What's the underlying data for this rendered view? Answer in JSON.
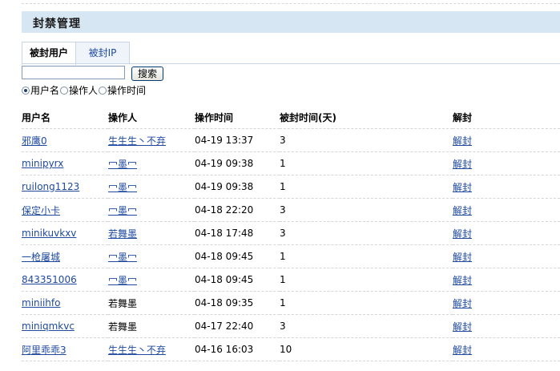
{
  "page_title": "封禁管理",
  "tabs": [
    {
      "label": "被封用户",
      "active": true
    },
    {
      "label": "被封IP",
      "active": false
    }
  ],
  "search": {
    "value": "",
    "button_label": "搜索"
  },
  "radio_options": [
    {
      "label": "用户名",
      "checked": true
    },
    {
      "label": "操作人",
      "checked": false
    },
    {
      "label": "操作时间",
      "checked": false
    }
  ],
  "table": {
    "headers": [
      "用户名",
      "操作人",
      "操作时间",
      "被封时间(天)",
      "解封"
    ],
    "rows": [
      {
        "username": "邪鹰0",
        "username_link": true,
        "operator": "生生生丶不弃",
        "operator_link": true,
        "time": "04-19 13:37",
        "days": "3",
        "action": "解封"
      },
      {
        "username": "minipyrx",
        "username_link": true,
        "operator": "冖墨冖",
        "operator_link": true,
        "time": "04-19 09:38",
        "days": "1",
        "action": "解封"
      },
      {
        "username": "ruilong1123",
        "username_link": true,
        "operator": "冖墨冖",
        "operator_link": true,
        "time": "04-19 09:38",
        "days": "1",
        "action": "解封"
      },
      {
        "username": "保定小卡",
        "username_link": true,
        "operator": "冖墨冖",
        "operator_link": true,
        "time": "04-18 22:20",
        "days": "3",
        "action": "解封"
      },
      {
        "username": "minikuvkxv",
        "username_link": true,
        "operator": "若舞墨",
        "operator_link": true,
        "time": "04-18 17:48",
        "days": "3",
        "action": "解封"
      },
      {
        "username": "一枪屠城",
        "username_link": true,
        "operator": "冖墨冖",
        "operator_link": true,
        "time": "04-18 09:45",
        "days": "1",
        "action": "解封"
      },
      {
        "username": "843351006",
        "username_link": true,
        "operator": "冖墨冖",
        "operator_link": true,
        "time": "04-18 09:45",
        "days": "1",
        "action": "解封"
      },
      {
        "username": "miniihfo",
        "username_link": true,
        "operator": "若舞墨",
        "operator_link": false,
        "time": "04-18 09:35",
        "days": "1",
        "action": "解封"
      },
      {
        "username": "miniqmkvc",
        "username_link": true,
        "operator": "若舞墨",
        "operator_link": false,
        "time": "04-17 22:40",
        "days": "3",
        "action": "解封"
      },
      {
        "username": "阿里乖乖3",
        "username_link": true,
        "operator": "生生生丶不弃",
        "operator_link": true,
        "time": "04-16 16:03",
        "days": "10",
        "action": "解封"
      }
    ]
  },
  "colors": {
    "header_bg": "#d7e6f3",
    "link": "#1f4aa0",
    "tab_border": "#c9d6e2"
  }
}
